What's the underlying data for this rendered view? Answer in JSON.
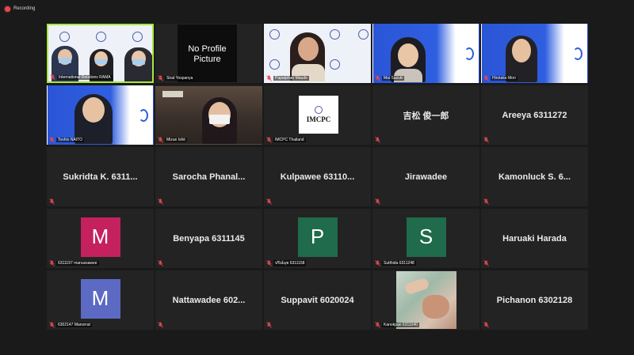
{
  "recording": {
    "label": "Recording",
    "color": "#e5484d"
  },
  "accent": {
    "active_speaker_border": "#a6e83f",
    "muted_mic": "#e5484d"
  },
  "tiles": [
    {
      "kind": "video",
      "label": "International Relations RAMA",
      "active": true
    },
    {
      "kind": "no-profile",
      "label": "Sirat Yospanya",
      "picture_text_1": "No Profile",
      "picture_text_2": "Picture"
    },
    {
      "kind": "video",
      "label": "Papatphan Maude"
    },
    {
      "kind": "video",
      "label": "Mai Suzuki"
    },
    {
      "kind": "video",
      "label": "Hirotake Mori"
    },
    {
      "kind": "video",
      "label": "Toshio NAITO"
    },
    {
      "kind": "video",
      "label": "Mizue Ishii"
    },
    {
      "kind": "logo",
      "label": "IMCPC Thailand",
      "logo_text": "IMCPC"
    },
    {
      "kind": "name",
      "name": "吉松 俊一郎"
    },
    {
      "kind": "name",
      "name": "Areeya 6311272"
    },
    {
      "kind": "name",
      "name": "Sukridta K. 6311..."
    },
    {
      "kind": "name",
      "name": "Sarocha Phanal..."
    },
    {
      "kind": "name",
      "name": "Kulpawee 63110..."
    },
    {
      "kind": "name",
      "name": "Jirawadee"
    },
    {
      "kind": "name",
      "name": "Kamonluck S. 6..."
    },
    {
      "kind": "avatar",
      "letter": "M",
      "color": "#c4215e",
      "label": "6311197 manussawee"
    },
    {
      "kind": "name",
      "name": "Benyapa 6311145"
    },
    {
      "kind": "avatar",
      "letter": "P",
      "color": "#1f6b4b",
      "label": "ปรีณ์นุช 6311158"
    },
    {
      "kind": "avatar",
      "letter": "S",
      "color": "#1f6b4b",
      "label": "Sutthida 6311248"
    },
    {
      "kind": "name",
      "name": "Haruaki Harada"
    },
    {
      "kind": "avatar",
      "letter": "M",
      "color": "#5c6ac4",
      "label": "6302147 Manorrat"
    },
    {
      "kind": "name",
      "name": "Nattawadee 602..."
    },
    {
      "kind": "name",
      "name": "Suppavit 6020024"
    },
    {
      "kind": "video",
      "label": "Kanokpan 6311040"
    },
    {
      "kind": "name",
      "name": "Pichanon 6302128"
    }
  ]
}
